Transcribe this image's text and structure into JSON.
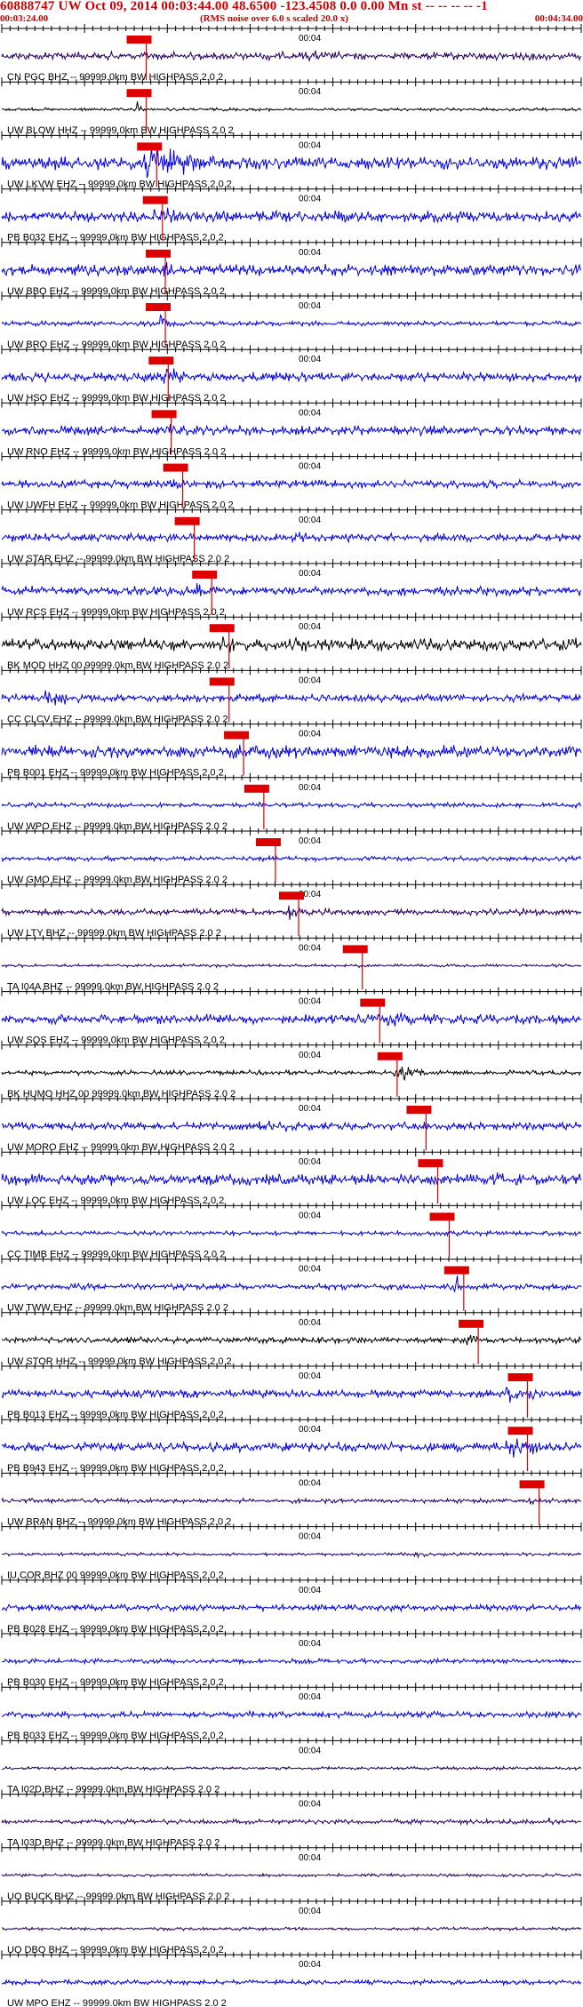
{
  "header": {
    "title": "60888747 UW Oct 09, 2014 00:03:44.00   48.6500 -123.4508  0.0 0.00 Mn st -- -- -- --  -1",
    "time_start": "00:03:24.00",
    "rms_note": "(RMS noise over 6.0 s scaled 20.0 x)",
    "time_end": "00:04:34.00",
    "text_color": "#cc0000"
  },
  "axis": {
    "minute_label": "00:04"
  },
  "colors": {
    "blue": "#0000ee",
    "black": "#000000",
    "navy": "#220066",
    "pick": "#dd0000",
    "axis": "#000000"
  },
  "traces": [
    {
      "label": "CN PGC BHZ -- 99999.0km BW  HIGHPASS  2.0  2",
      "color": "navy",
      "amp": 5,
      "pick": 0.237,
      "event": [
        0.5,
        0.72,
        7
      ]
    },
    {
      "label": "UW BLOW HHZ -- 99999.0km BW  HIGHPASS  2.0  2",
      "color": "black",
      "amp": 2,
      "pick": 0.237,
      "event": [
        0.23,
        0.25,
        12
      ]
    },
    {
      "label": "UW LKVW EHZ -- 99999.0km BW  HIGHPASS  2.0  2",
      "color": "blue",
      "amp": 8,
      "pick": 0.255,
      "event": [
        0.21,
        0.47,
        26
      ]
    },
    {
      "label": "PB B032 EHZ -- 99999.0km BW  HIGHPASS  2.0  2",
      "color": "blue",
      "amp": 7,
      "pick": 0.265,
      "event": [
        0.25,
        0.38,
        14
      ]
    },
    {
      "label": "UW BBO EHZ -- 99999.0km BW  HIGHPASS  2.0  2",
      "color": "blue",
      "amp": 7,
      "pick": 0.27,
      "event": [
        0.27,
        0.36,
        17
      ]
    },
    {
      "label": "UW BRO EHZ -- 99999.0km BW  HIGHPASS  2.0  2",
      "color": "blue",
      "amp": 3,
      "pick": 0.27,
      "event": [
        0.27,
        0.3,
        15
      ]
    },
    {
      "label": "UW HSO EHZ -- 99999.0km BW  HIGHPASS  2.0  2",
      "color": "blue",
      "amp": 6,
      "pick": 0.275,
      "event": [
        0.27,
        0.36,
        15
      ]
    },
    {
      "label": "UW RNO EHZ -- 99999.0km BW  HIGHPASS  2.0  2",
      "color": "blue",
      "amp": 6,
      "pick": 0.28,
      "event": [
        0.28,
        0.34,
        12
      ]
    },
    {
      "label": "UW UWFH EHZ -- 99999.0km BW  HIGHPASS  2.0  2",
      "color": "blue",
      "amp": 5,
      "pick": 0.3,
      "event": [
        0.29,
        0.34,
        12
      ]
    },
    {
      "label": "UW STAR EHZ -- 99999.0km BW  HIGHPASS  2.0  2",
      "color": "blue",
      "amp": 5,
      "pick": 0.32,
      "event": [
        0.5,
        0.56,
        11
      ]
    },
    {
      "label": "UW RCS EHZ -- 99999.0km BW  HIGHPASS  2.0  2",
      "color": "blue",
      "amp": 6,
      "pick": 0.35,
      "event": [
        0.33,
        0.38,
        12
      ]
    },
    {
      "label": "BK MOD HHZ 00 99999.0km BW  HIGHPASS  2.0  2",
      "color": "black",
      "amp": 8,
      "pick": 0.38,
      "event": [
        0.36,
        0.5,
        12
      ]
    },
    {
      "label": "CC CLCV EHZ -- 99999.0km BW  HIGHPASS  2.0  2",
      "color": "blue",
      "amp": 5,
      "pick": 0.38,
      "event": [
        0.06,
        0.2,
        12
      ]
    },
    {
      "label": "PB B001 EHZ -- 99999.0km BW  HIGHPASS  2.0  2",
      "color": "blue",
      "amp": 8,
      "pick": 0.405,
      "event": [
        0.38,
        0.45,
        14
      ]
    },
    {
      "label": "UW WPO EHZ -- 99999.0km BW  HIGHPASS  2.0  2",
      "color": "blue",
      "amp": 3,
      "pick": 0.44,
      "event": [
        0.44,
        0.46,
        5
      ]
    },
    {
      "label": "UW GMO EHZ -- 99999.0km BW  HIGHPASS  2.0  2",
      "color": "blue",
      "amp": 3,
      "pick": 0.46,
      "event": [
        0.46,
        0.48,
        4
      ]
    },
    {
      "label": "UW LTY BHZ -- 99999.0km BW  HIGHPASS  2.0  2",
      "color": "navy",
      "amp": 4,
      "pick": 0.5,
      "event": [
        0.49,
        0.53,
        12
      ]
    },
    {
      "label": "TA I04A BHZ -- 99999.0km BW  HIGHPASS  2.0  2",
      "color": "navy",
      "amp": 2,
      "pick": 0.61,
      "event": [
        0.61,
        0.65,
        4
      ]
    },
    {
      "label": "UW SQS EHZ -- 99999.0km BW  HIGHPASS  2.0  2",
      "color": "blue",
      "amp": 6,
      "pick": 0.64,
      "event": [
        0.62,
        0.9,
        10
      ]
    },
    {
      "label": "BK HUMO HHZ 00 99999.0km BW  HIGHPASS  2.0  2",
      "color": "black",
      "amp": 3,
      "pick": 0.67,
      "event": [
        0.67,
        0.76,
        14
      ]
    },
    {
      "label": "UW MORO EHZ -- 99999.0km BW  HIGHPASS  2.0  2",
      "color": "blue",
      "amp": 5,
      "pick": 0.72,
      "event": [
        0.38,
        0.84,
        8
      ]
    },
    {
      "label": "UW LOC EHZ -- 99999.0km BW  HIGHPASS  2.0  2",
      "color": "blue",
      "amp": 7,
      "pick": 0.74,
      "event": [
        0.84,
        0.91,
        16
      ]
    },
    {
      "label": "CC TIMB EHZ -- 99999.0km BW  HIGHPASS  2.0  2",
      "color": "blue",
      "amp": 3,
      "pick": 0.76,
      "event": [
        0.76,
        0.79,
        4
      ]
    },
    {
      "label": "UW TWW EHZ -- 99999.0km BW  HIGHPASS  2.0  2",
      "color": "blue",
      "amp": 4,
      "pick": 0.785,
      "event": [
        0.78,
        0.8,
        18
      ]
    },
    {
      "label": "UW STOR HHZ -- 99999.0km BW  HIGHPASS  2.0  2",
      "color": "black",
      "amp": 4,
      "pick": 0.81,
      "event": [
        0.8,
        0.83,
        14
      ]
    },
    {
      "label": "PB B013 EHZ -- 99999.0km BW  HIGHPASS  2.0  2",
      "color": "blue",
      "amp": 5,
      "pick": 0.895,
      "event": [
        0.86,
        0.99,
        16
      ]
    },
    {
      "label": "PB B943 EHZ -- 99999.0km BW  HIGHPASS  2.0  2",
      "color": "blue",
      "amp": 6,
      "pick": 0.895,
      "event": [
        0.86,
        0.99,
        16
      ]
    },
    {
      "label": "UW BRAN BHZ -- 99999.0km BW  HIGHPASS  2.0  2",
      "color": "navy",
      "amp": 3,
      "pick": 0.915,
      "event": [
        0.91,
        0.93,
        10
      ]
    },
    {
      "label": "IU COR BHZ 00 99999.0km BW  HIGHPASS  2.0  2",
      "color": "navy",
      "amp": 2,
      "event": [
        0.7,
        0.8,
        4
      ]
    },
    {
      "label": "PB B028 EHZ -- 99999.0km BW  HIGHPASS  2.0  2",
      "color": "blue",
      "amp": 4
    },
    {
      "label": "PB B030 EHZ -- 99999.0km BW  HIGHPASS  2.0  2",
      "color": "blue",
      "amp": 3
    },
    {
      "label": "PB B033 EHZ -- 99999.0km BW  HIGHPASS  2.0  2",
      "color": "blue",
      "amp": 4
    },
    {
      "label": "TA I02D BHZ -- 99999.0km BW  HIGHPASS  2.0  2",
      "color": "navy",
      "amp": 2
    },
    {
      "label": "TA I03D BHZ -- 99999.0km BW  HIGHPASS  2.0  2",
      "color": "navy",
      "amp": 3,
      "event": [
        0.94,
        0.96,
        8
      ]
    },
    {
      "label": "UO BUCK BHZ -- 99999.0km BW  HIGHPASS  2.0  2",
      "color": "navy",
      "amp": 2
    },
    {
      "label": "UO DBO BHZ -- 99999.0km BW  HIGHPASS  2.0  2",
      "color": "navy",
      "amp": 2
    },
    {
      "label": "UW MPO EHZ -- 99999.0km BW  HIGHPASS  2.0  2",
      "color": "blue",
      "amp": 3
    }
  ]
}
